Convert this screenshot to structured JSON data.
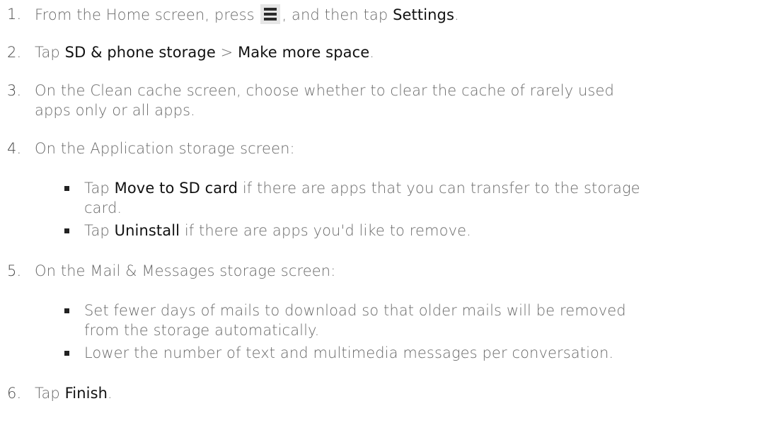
{
  "steps": [
    {
      "num": "1.",
      "parts": [
        "From the Home screen, press ",
        ", and then tap ",
        "Settings",
        "."
      ],
      "icon": "menu-icon"
    },
    {
      "num": "2.",
      "parts": [
        "Tap ",
        "SD & phone storage",
        " > ",
        "Make more space",
        "."
      ]
    },
    {
      "num": "3.",
      "lines": [
        "On the Clean cache screen, choose whether to clear the cache of rarely used",
        "apps only or all apps."
      ]
    },
    {
      "num": "4.",
      "text": "On the Application storage screen:",
      "bullets": [
        {
          "parts": [
            "Tap ",
            "Move to SD card",
            " if there are apps that you can transfer to the storage",
            "card."
          ]
        },
        {
          "parts": [
            "Tap ",
            "Uninstall",
            " if there are apps you'd like to remove."
          ]
        }
      ]
    },
    {
      "num": "5.",
      "text": "On the Mail & Messages storage screen:",
      "bullets": [
        {
          "lines": [
            "Set fewer days of mails to download so that older mails will be removed",
            "from the storage automatically."
          ]
        },
        {
          "lines": [
            "Lower the number of text and multimedia messages per conversation."
          ]
        }
      ]
    },
    {
      "num": "6.",
      "parts": [
        "Tap ",
        "Finish",
        "."
      ]
    }
  ]
}
